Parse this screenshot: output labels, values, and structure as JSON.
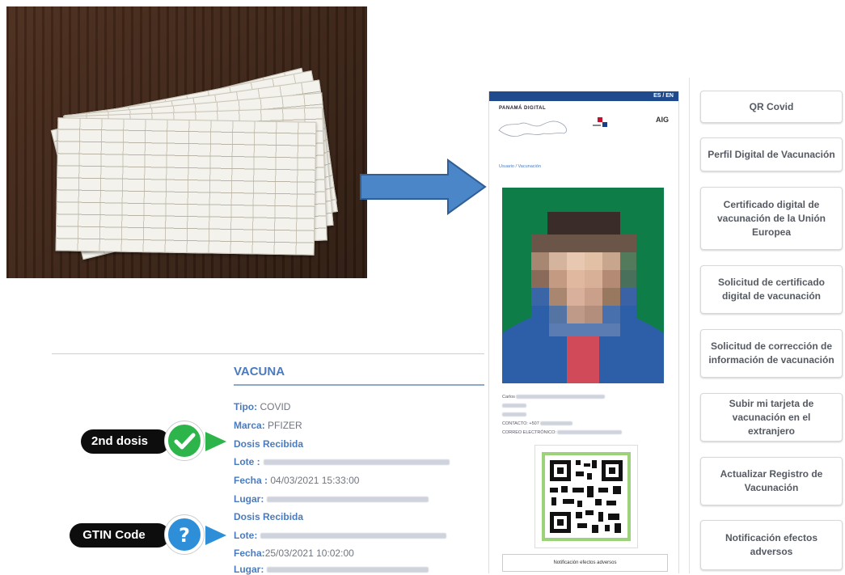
{
  "phone": {
    "lang_toggle": "ES / EN",
    "brand": "PANAMÁ DIGITAL",
    "aig_logo": "AIG",
    "breadcrumb": "Usuario / Vacunación",
    "info_name_label": "Carlos",
    "info_contact_label": "CONTACTO: +507",
    "info_email_label": "CORREO ELECTRÓNICO:",
    "notif_button": "Notificación efectos adversos"
  },
  "menu": [
    {
      "label": "QR Covid"
    },
    {
      "label": "Perfil Digital de Vacunación"
    },
    {
      "label": "Certificado digital de vacunación de la Unión Europea"
    },
    {
      "label": "Solicitud de certificado digital de vacunación"
    },
    {
      "label": "Solicitud de corrección de información de vacunación"
    },
    {
      "label": "Subir mi tarjeta de vacunación en el extranjero"
    },
    {
      "label": "Actualizar Registro de Vacunación"
    },
    {
      "label": "Notificación efectos adversos"
    }
  ],
  "vacuna": {
    "title": "VACUNA",
    "tipo_label": "Tipo:",
    "tipo_value": "COVID",
    "marca_label": "Marca:",
    "marca_value": "PFIZER",
    "dose1_heading": "Dosis Recibida",
    "dose1_lote_label": "Lote :",
    "dose1_fecha_label": "Fecha :",
    "dose1_fecha_value": "04/03/2021 15:33:00",
    "dose1_lugar_label": "Lugar:",
    "dose2_heading": "Dosis Recibida",
    "dose2_lote_label": "Lote:",
    "dose2_fecha_label": "Fecha:",
    "dose2_fecha_value": "25/03/2021 10:02:00",
    "dose2_lugar_label": "Lugar:"
  },
  "callouts": {
    "second_dose": "2nd dosis",
    "gtin": "GTIN Code",
    "second_dose_icon": "check-icon",
    "gtin_icon": "question-icon",
    "green": "#2db44a",
    "blue": "#2e8fd8"
  }
}
